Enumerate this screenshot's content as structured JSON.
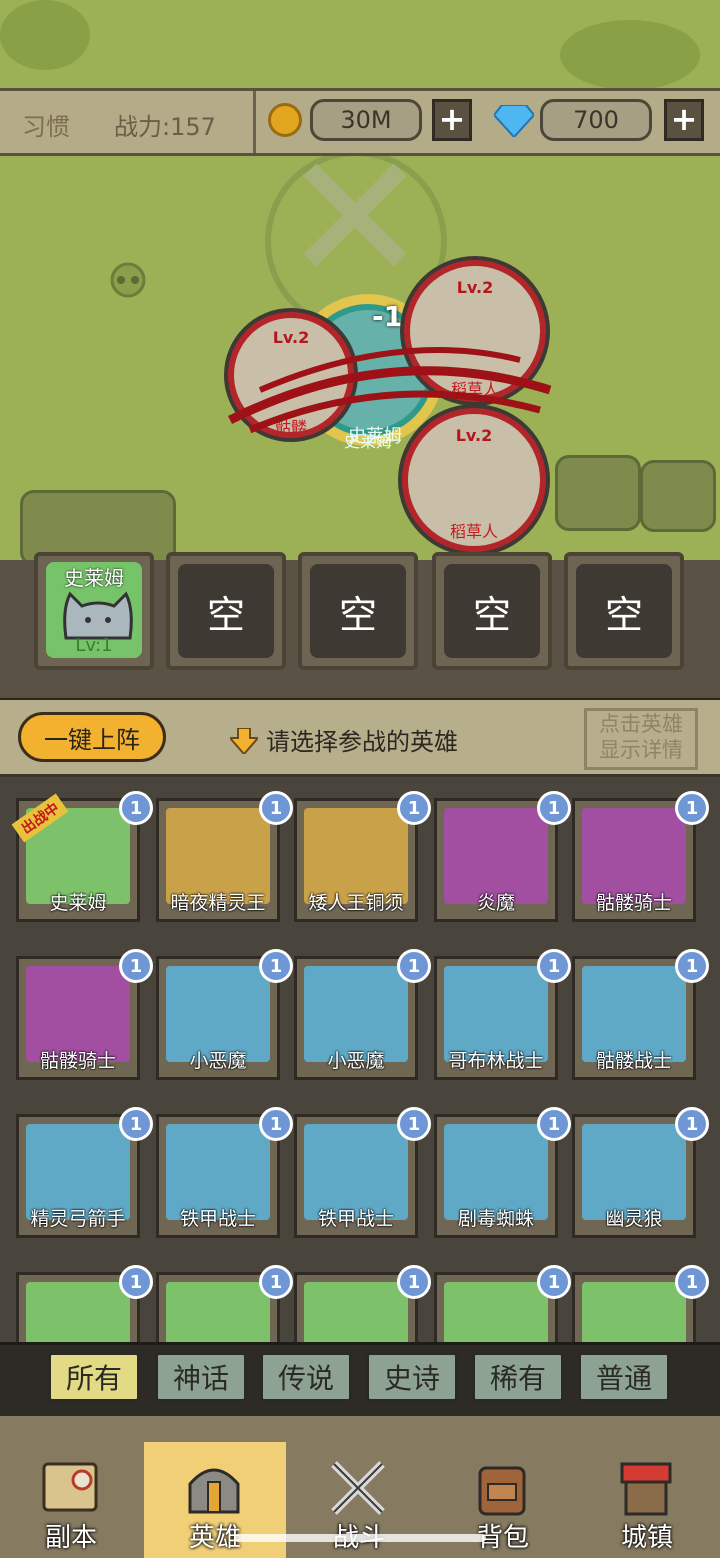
{
  "topbar": {
    "habit_label": "习惯",
    "power_label": "战力:157",
    "gold_value": "30M",
    "gem_value": "700",
    "plus_label": "+"
  },
  "battle": {
    "damage_text": "-1",
    "player_unit": {
      "name": "史莱姆"
    },
    "enemies": [
      {
        "level": "Lv.2",
        "name": "骷髅"
      },
      {
        "level": "Lv.2",
        "name": "稻草人"
      },
      {
        "level": "Lv.2",
        "name": "稻草人"
      }
    ]
  },
  "party_slots": [
    {
      "name": "史莱姆",
      "level": "Lv:1"
    },
    {
      "label": "空"
    },
    {
      "label": "空"
    },
    {
      "label": "空"
    },
    {
      "label": "空"
    }
  ],
  "hero_panel": {
    "auto_deploy_label": "一键上阵",
    "hint_text": "请选择参战的英雄",
    "detail_line1": "点击英雄",
    "detail_line2": "显示详情",
    "fighting_tag": "出战中",
    "heroes": [
      {
        "name": "史莱姆",
        "count": "1",
        "bg": "#7dc26a"
      },
      {
        "name": "暗夜精灵王",
        "count": "1",
        "bg": "#c8a148"
      },
      {
        "name": "矮人王铜须",
        "count": "1",
        "bg": "#c8a148"
      },
      {
        "name": "炎魔",
        "count": "1",
        "bg": "#a24ea1"
      },
      {
        "name": "骷髅骑士",
        "count": "1",
        "bg": "#a24ea1"
      },
      {
        "name": "骷髅骑士",
        "count": "1",
        "bg": "#a24ea1"
      },
      {
        "name": "小恶魔",
        "count": "1",
        "bg": "#5fa8c6"
      },
      {
        "name": "小恶魔",
        "count": "1",
        "bg": "#5fa8c6"
      },
      {
        "name": "哥布林战士",
        "count": "1",
        "bg": "#5fa8c6"
      },
      {
        "name": "骷髅战士",
        "count": "1",
        "bg": "#5fa8c6"
      },
      {
        "name": "精灵弓箭手",
        "count": "1",
        "bg": "#5fa8c6"
      },
      {
        "name": "铁甲战士",
        "count": "1",
        "bg": "#5fa8c6"
      },
      {
        "name": "铁甲战士",
        "count": "1",
        "bg": "#5fa8c6"
      },
      {
        "name": "剧毒蜘蛛",
        "count": "1",
        "bg": "#5fa8c6"
      },
      {
        "name": "幽灵狼",
        "count": "1",
        "bg": "#5fa8c6"
      },
      {
        "name": "",
        "count": "1",
        "bg": "#7dc26a"
      },
      {
        "name": "",
        "count": "1",
        "bg": "#7dc26a"
      },
      {
        "name": "",
        "count": "1",
        "bg": "#7dc26a"
      },
      {
        "name": "",
        "count": "1",
        "bg": "#7dc26a"
      },
      {
        "name": "",
        "count": "1",
        "bg": "#7dc26a"
      }
    ]
  },
  "filters": [
    "所有",
    "神话",
    "传说",
    "史诗",
    "稀有",
    "普通"
  ],
  "nav": [
    {
      "label": "副本",
      "icon": "map-icon"
    },
    {
      "label": "英雄",
      "icon": "helmet-icon"
    },
    {
      "label": "战斗",
      "icon": "crossed-swords-icon"
    },
    {
      "label": "背包",
      "icon": "backpack-icon"
    },
    {
      "label": "城镇",
      "icon": "shop-icon"
    }
  ]
}
